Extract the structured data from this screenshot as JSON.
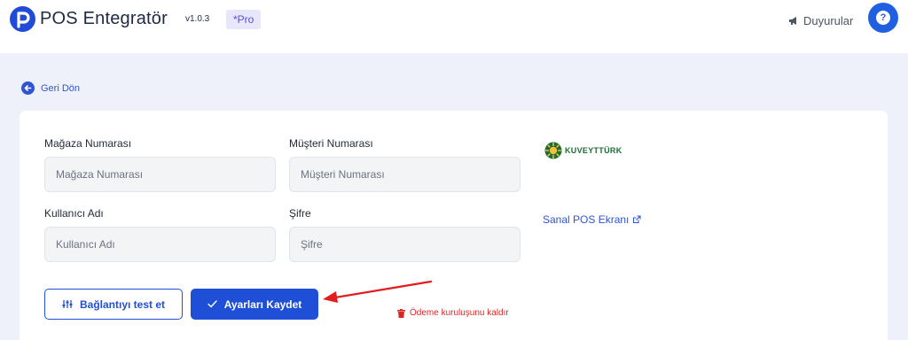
{
  "header": {
    "app_title": "POS Entegratör",
    "version": "v1.0.3",
    "badge": "*Pro",
    "announcements_label": "Duyurular",
    "help_symbol": "?"
  },
  "back_link": {
    "label": "Geri Dön"
  },
  "form": {
    "store_number": {
      "label": "Mağaza Numarası",
      "placeholder": "Mağaza Numarası",
      "value": ""
    },
    "customer_number": {
      "label": "Müşteri Numarası",
      "placeholder": "Müşteri Numarası",
      "value": ""
    },
    "username": {
      "label": "Kullanıcı Adı",
      "placeholder": "Kullanıcı Adı",
      "value": ""
    },
    "password": {
      "label": "Şifre",
      "placeholder": "Şifre",
      "value": ""
    }
  },
  "actions": {
    "test_label": "Bağlantıyı test et",
    "save_label": "Ayarları Kaydet",
    "remove_label": "Ödeme kuruluşunu kaldır"
  },
  "bank": {
    "logo_text": "KUVEYTTÜRK",
    "pos_link_label": "Sanal POS Ekranı"
  },
  "colors": {
    "accent": "#1f4fd6",
    "background": "#eef1fa",
    "danger": "#dc2626",
    "annotation_arrow": "#e11d1d",
    "bank_brand": "#1f6b3a"
  },
  "icons": {
    "logo": "p-logo-icon",
    "announcements": "megaphone-icon",
    "help": "question-circle-icon",
    "back": "arrow-left-circle-icon",
    "test": "sliders-icon",
    "save": "check-icon",
    "remove": "trash-icon",
    "external": "external-link-icon"
  }
}
